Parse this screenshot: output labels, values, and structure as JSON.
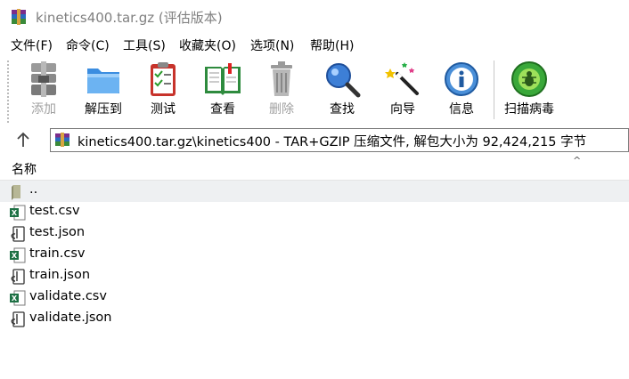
{
  "window": {
    "title": "kinetics400.tar.gz (评估版本)"
  },
  "menu": [
    "文件(F)",
    "命令(C)",
    "工具(S)",
    "收藏夹(O)",
    "选项(N)",
    "帮助(H)"
  ],
  "toolbar": {
    "add": "添加",
    "extract": "解压到",
    "test": "测试",
    "view": "查看",
    "delete": "删除",
    "find": "查找",
    "wizard": "向导",
    "info": "信息",
    "virus_scan": "扫描病毒"
  },
  "address": {
    "path": "kinetics400.tar.gz\\kinetics400 - TAR+GZIP 压缩文件, 解包大小为 92,424,215 字节"
  },
  "list": {
    "column_name": "名称",
    "sort_indicator": "^",
    "parent": "..",
    "files": [
      {
        "name": "test.csv",
        "icon": "excel-icon"
      },
      {
        "name": "test.json",
        "icon": "json-file-icon"
      },
      {
        "name": "train.csv",
        "icon": "excel-icon"
      },
      {
        "name": "train.json",
        "icon": "json-file-icon"
      },
      {
        "name": "validate.csv",
        "icon": "excel-icon"
      },
      {
        "name": "validate.json",
        "icon": "json-file-icon"
      }
    ]
  },
  "colors": {
    "disabled_text": "#a0a0a0",
    "title_text": "#808080",
    "excel_green": "#1d7044",
    "row_highlight": "#eef0f2"
  }
}
